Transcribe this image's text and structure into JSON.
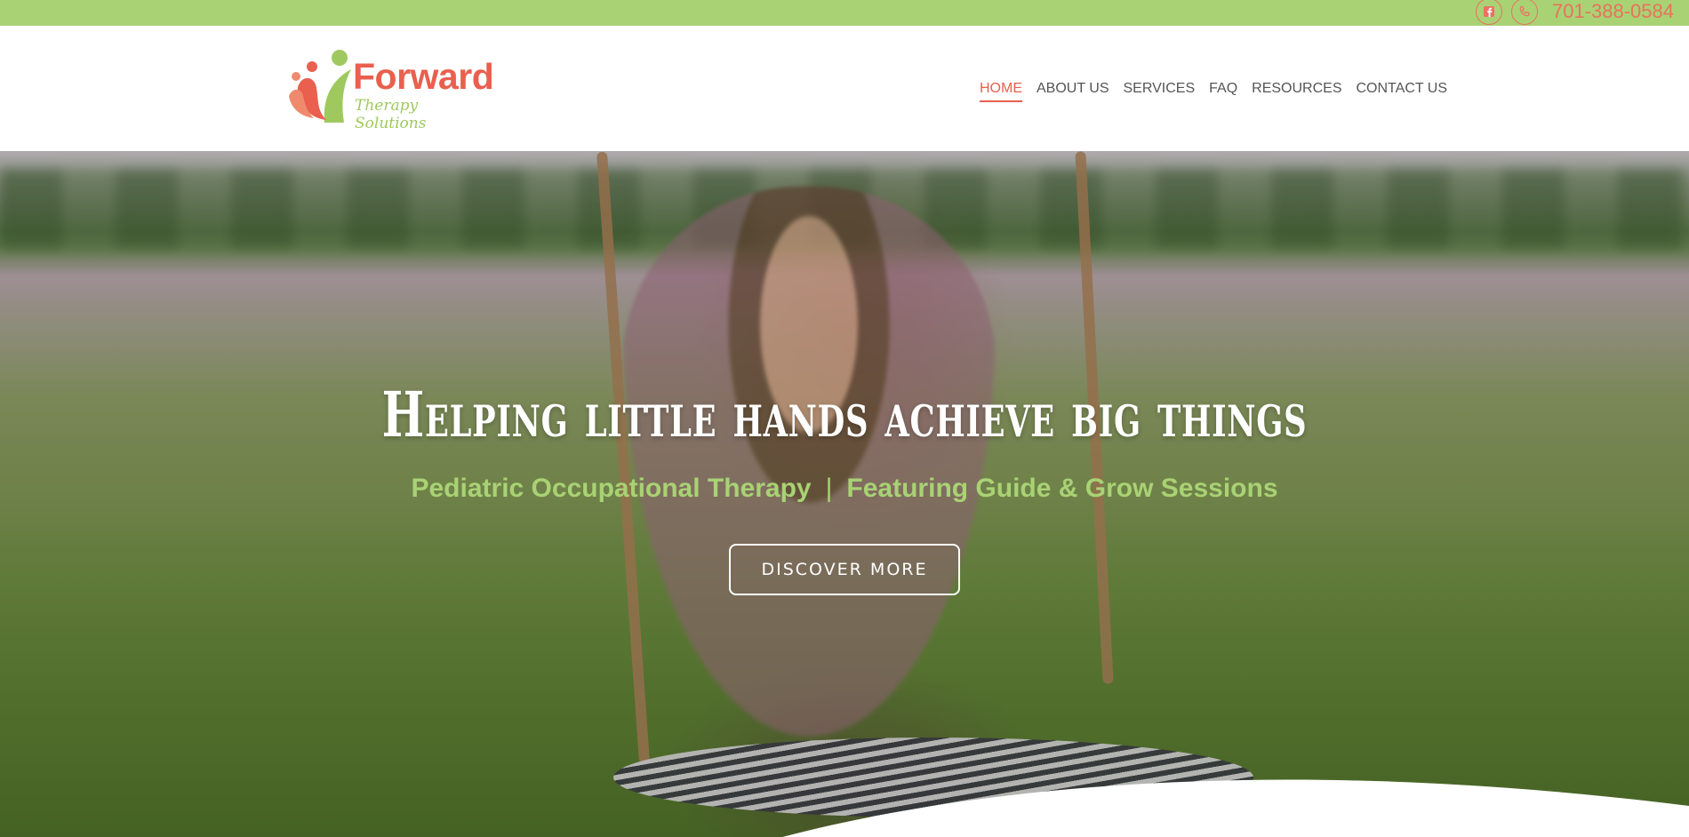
{
  "topbar": {
    "phone": "701-388-0584",
    "facebook_icon": "facebook-icon",
    "phone_icon": "phone-icon"
  },
  "logo": {
    "name": "Forward",
    "tagline": "Therapy Solutions"
  },
  "nav": {
    "items": [
      {
        "label": "HOME"
      },
      {
        "label": "ABOUT US"
      },
      {
        "label": "SERVICES"
      },
      {
        "label": "FAQ"
      },
      {
        "label": "RESOURCES"
      },
      {
        "label": "CONTACT US"
      }
    ],
    "active": "HOME"
  },
  "hero": {
    "title": "Helping little hands achieve big things",
    "subtitle_left": "Pediatric Occupational Therapy",
    "subtitle_separator": "|",
    "subtitle_right": "Featuring Guide & Grow Sessions",
    "cta_label": "DISCOVER MORE"
  },
  "colors": {
    "topbar": "#a9d274",
    "accent": "#e9604f",
    "green": "#a9d274"
  }
}
